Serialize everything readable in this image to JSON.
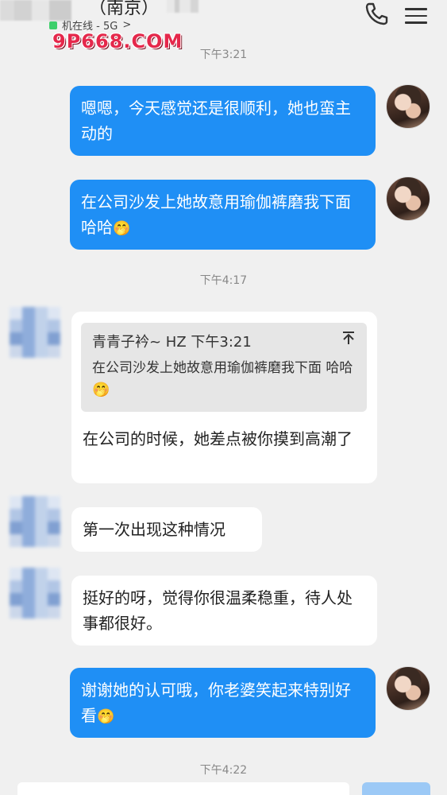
{
  "header": {
    "contact_name": "（南京）",
    "status": "机在线 - 5G",
    "status_chevron": ">",
    "watermark": "9P668.COM"
  },
  "timestamps": [
    "下午3:21",
    "下午4:17",
    "下午4:22"
  ],
  "messages": [
    {
      "side": "me",
      "text": "嗯嗯，今天感觉还是很顺利，她也蛮主动的"
    },
    {
      "side": "me",
      "text": "在公司沙发上她故意用瑜伽裤磨我下面 哈哈",
      "emoji": "🤭"
    },
    {
      "side": "them",
      "text": "在公司的时候，她差点被你摸到高潮了"
    },
    {
      "side": "them",
      "text": "第一次出现这种情况"
    },
    {
      "side": "them",
      "text": "挺好的呀，觉得你很温柔稳重，待人处事都很好。"
    },
    {
      "side": "me",
      "text": "谢谢她的认可哦，你老婆笑起来特别好看",
      "emoji": "🤭"
    }
  ],
  "quote": {
    "author": "青青子衿~ HZ",
    "time": "下午3:21",
    "text": "在公司沙发上她故意用瑜伽裤磨我下面 哈哈",
    "emoji": "🤭",
    "icon": "pin-up-icon"
  },
  "colors": {
    "my_bubble": "#1f8ff5",
    "their_bubble": "#ffffff",
    "background": "#f0f0f0"
  }
}
